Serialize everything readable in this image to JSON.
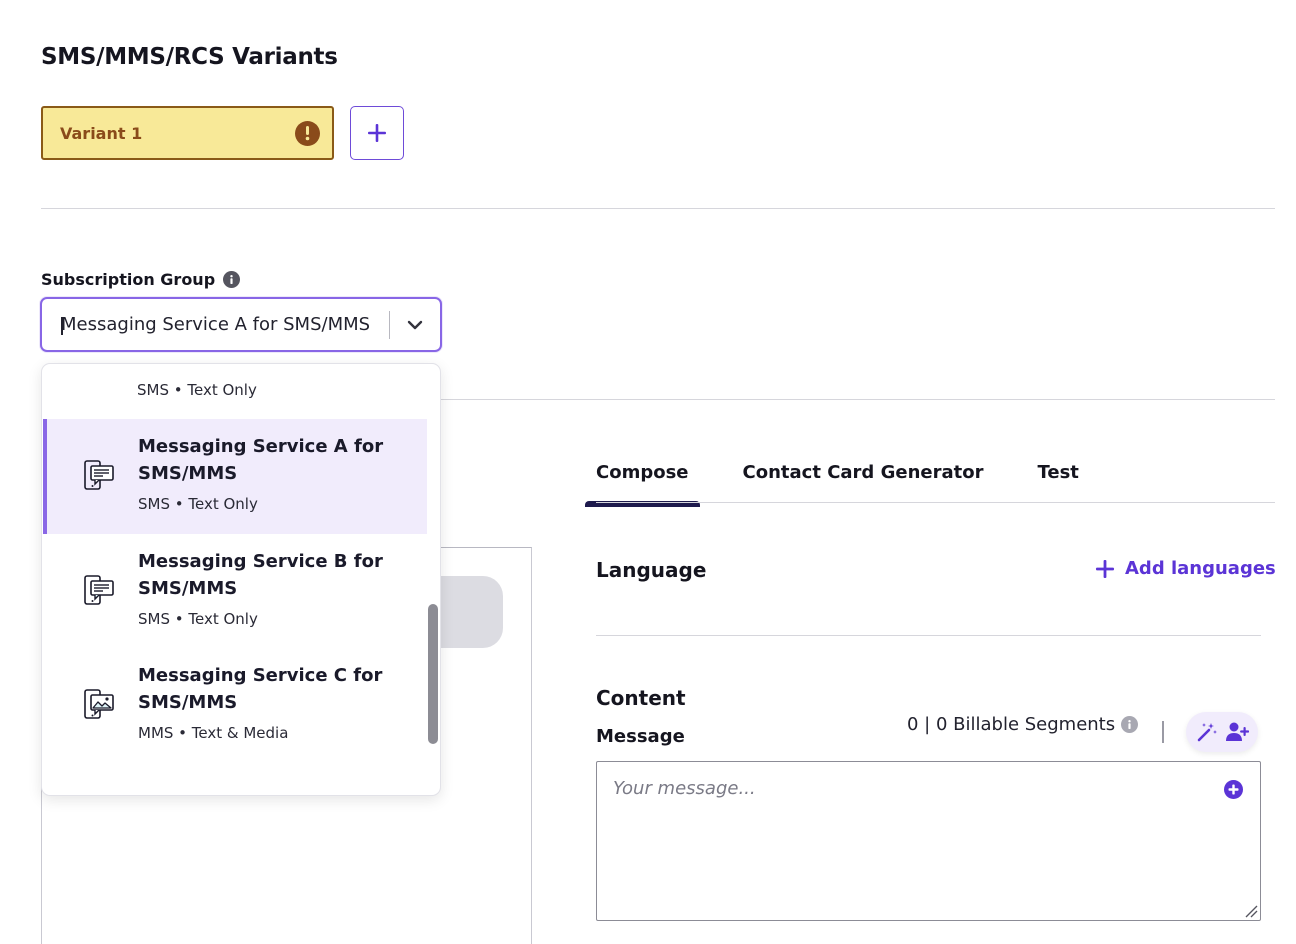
{
  "page": {
    "title": "SMS/MMS/RCS Variants"
  },
  "variants": {
    "items": [
      {
        "label": "Variant 1",
        "status": "warning"
      }
    ]
  },
  "subscription": {
    "label": "Subscription Group",
    "selected_value": "Messaging Service A for SMS/MMS",
    "options_partial_subtitle": "SMS • Text Only",
    "options": [
      {
        "title": "Messaging Service A for SMS/MMS",
        "subtitle": "SMS • Text Only",
        "icon": "sms-phone-icon",
        "selected": true
      },
      {
        "title": "Messaging Service B for SMS/MMS",
        "subtitle": "SMS • Text Only",
        "icon": "sms-phone-icon",
        "selected": false
      },
      {
        "title": "Messaging Service C for SMS/MMS",
        "subtitle": "MMS • Text & Media",
        "icon": "mms-phone-icon",
        "selected": false
      }
    ]
  },
  "tabs": [
    {
      "label": "Compose",
      "active": true
    },
    {
      "label": "Contact Card Generator",
      "active": false
    },
    {
      "label": "Test",
      "active": false
    }
  ],
  "language": {
    "heading": "Language",
    "add_label": "Add languages"
  },
  "content": {
    "heading": "Content",
    "message_label": "Message",
    "segments": "0 | 0 Billable Segments",
    "placeholder": "Your message..."
  },
  "colors": {
    "accent": "#5b34d6",
    "warning_bg": "#f8e998",
    "warning_fg": "#8a4b1a",
    "selected_bg": "#f1ecfc"
  }
}
